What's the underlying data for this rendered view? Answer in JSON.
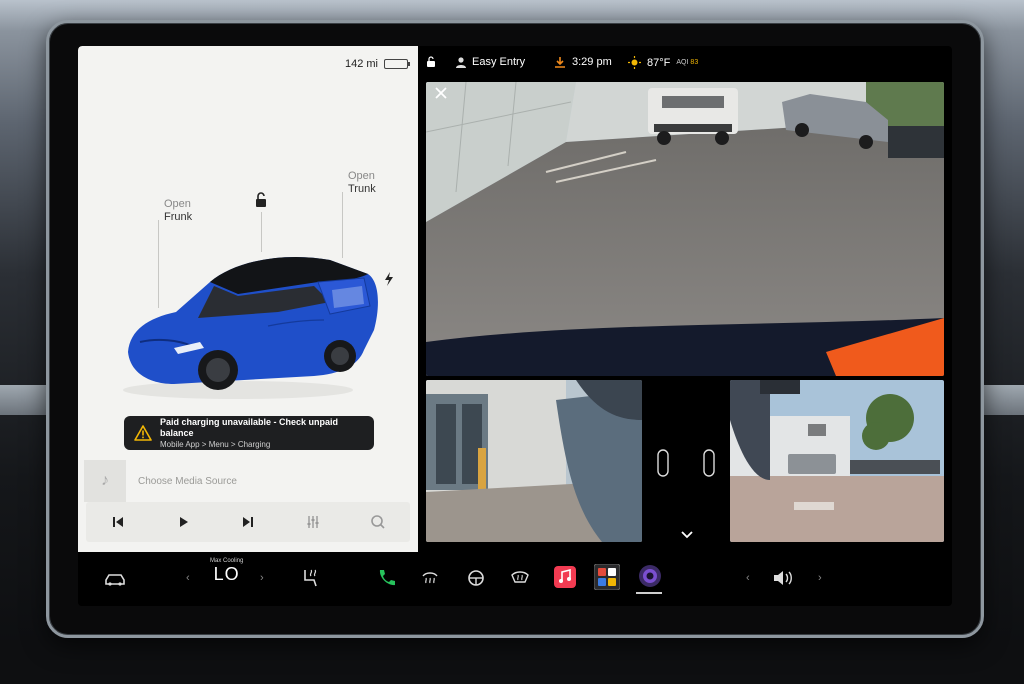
{
  "car_panel": {
    "range": "142 mi",
    "frunk": {
      "line1": "Open",
      "line2": "Frunk"
    },
    "trunk": {
      "line1": "Open",
      "line2": "Trunk"
    },
    "alert": {
      "title": "Paid charging unavailable - Check unpaid balance",
      "subtitle": "Mobile App > Menu > Charging"
    },
    "media": {
      "placeholder": "Choose Media Source"
    },
    "colors": {
      "car_body": "#1f4fc9",
      "panel_bg": "#f3f3f1"
    }
  },
  "status_bar": {
    "profile": "Easy Entry",
    "time": "3:29 pm",
    "temperature": "87°F",
    "aqi_label": "AQI",
    "aqi_value": "83"
  },
  "dock": {
    "climate_caption": "Max Cooling",
    "climate_value": "LO",
    "icons": [
      "car-icon",
      "seat-heat-icon",
      "phone-icon",
      "defrost-rear-icon",
      "steering-heat-icon",
      "defrost-front-icon",
      "music-icon",
      "apps-icon",
      "camera-icon",
      "volume-icon"
    ]
  }
}
